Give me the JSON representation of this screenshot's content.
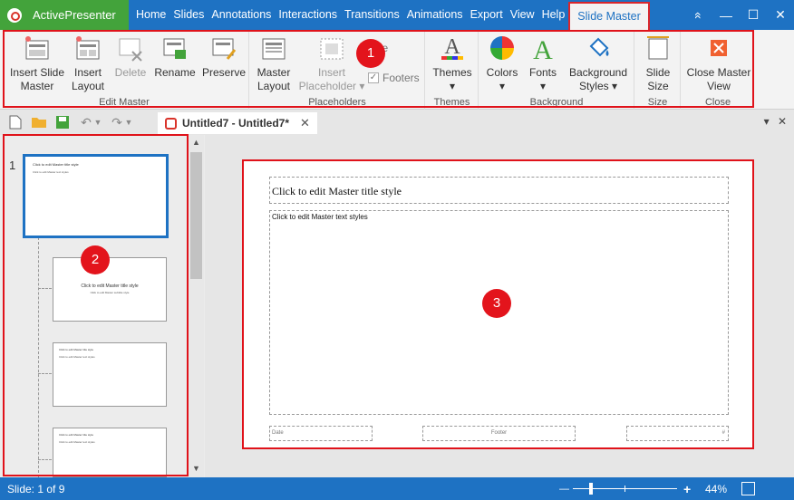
{
  "app": {
    "name": "ActivePresenter"
  },
  "menu": [
    "Home",
    "Slides",
    "Annotations",
    "Interactions",
    "Transitions",
    "Animations",
    "Export",
    "View",
    "Help"
  ],
  "menu_active": "Slide Master",
  "window": {
    "ribbon_toggle": "«",
    "minimize": "—",
    "maximize": "☐",
    "close": "✕"
  },
  "ribbon": {
    "edit_master": {
      "label": "Edit Master",
      "insert_slide_master": "Insert Slide\nMaster",
      "insert_layout": "Insert\nLayout",
      "delete": "Delete",
      "rename": "Rename",
      "preserve": "Preserve"
    },
    "placeholders": {
      "label": "Placeholders",
      "master_layout": "Master\nLayout",
      "insert_placeholder": "Insert\nPlaceholder ▾",
      "title": "Title",
      "footers": "Footers"
    },
    "themes": {
      "label": "Themes",
      "themes": "Themes\n▾"
    },
    "background": {
      "label": "Background",
      "colors": "Colors\n▾",
      "fonts": "Fonts\n▾",
      "background_styles": "Background\nStyles ▾"
    },
    "size": {
      "label": "Size",
      "slide_size": "Slide\nSize"
    },
    "close": {
      "label": "Close",
      "close_master_view": "Close Master\nView"
    }
  },
  "document": {
    "tab": "Untitled7 - Untitled7*",
    "tab_close": "✕"
  },
  "slides": {
    "number": "1",
    "thumb1": {
      "title": "Click to edit Master title style",
      "text": "Click to edit Master text styles"
    },
    "thumb2": {
      "title": "Click to edit Master title style",
      "sub": "Click to edit Master subtitle style"
    },
    "thumb3": {
      "title": "Click to edit Master title style",
      "text": "Click to edit Master text styles"
    },
    "thumb4": {
      "title": "Click to edit Master title style",
      "text": "Click to edit Master text styles"
    }
  },
  "canvas": {
    "title": "Click to edit Master title style",
    "body": "Click to edit Master text styles",
    "date": "Date",
    "footer": "Footer",
    "number": "#"
  },
  "badges": [
    "1",
    "2",
    "3"
  ],
  "status": {
    "slide": "Slide: 1 of 9",
    "zoom": "44%",
    "zoom_minus": "—",
    "zoom_plus": "+"
  },
  "colors": {
    "accent": "#1e72c3",
    "brand": "#43a33b",
    "highlight": "#e0121a"
  }
}
